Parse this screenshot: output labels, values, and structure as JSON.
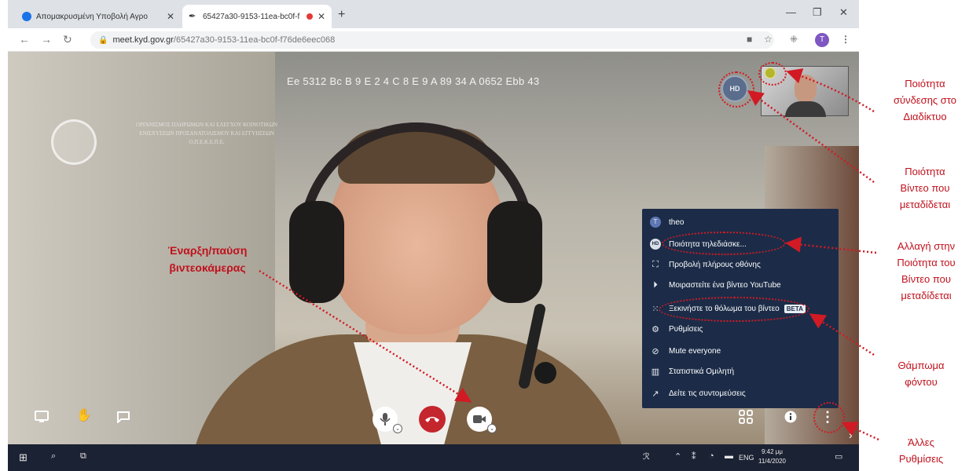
{
  "browser": {
    "tabs": [
      {
        "title": "Απομακρυσμένη Υποβολή Αγρο",
        "favicon": "plus-circle-icon",
        "favicon_color": "#1a73e8"
      },
      {
        "title": "65427a30-9153-11ea-bc0f-f",
        "favicon": "feather-icon",
        "favicon_color": "#333333",
        "recording": true
      }
    ],
    "address": {
      "host": "meet.kyd.gov.gr",
      "path": "/65427a30-9153-11ea-bc0f-f76de6eec068"
    },
    "profile_initial": "T"
  },
  "meeting": {
    "room_code": "Ee 5312 Bc B 9 E 2 4 C 8 E 9 A 89 34 A 0652 Ebb 43",
    "watermark_lines": [
      "ΟΡΓΑΝΙΣΜΟΣ ΠΛΗΡΩΜΩΝ ΚΑΙ ΕΛΕΓΧΟΥ ΚΟΙΝΟΤΙΚΩΝ",
      "ΕΝΙΣΧΥΣΕΩΝ ΠΡΟΣΑΝΑΤΟΛΙΣΜΟΥ ΚΑΙ ΕΓΓΥΗΣΕΩΝ",
      "Ο.Π.Ε.Κ.Ε.Π.Ε."
    ],
    "logo_text": "Ο.Π.Ε.Κ.Ε.Π.Ε.",
    "quality_badge": "HD",
    "connection_indicator_color": "#b5b52e"
  },
  "menu": {
    "items": [
      {
        "label": "theo",
        "icon": "user-avatar-icon",
        "avatar": "T"
      },
      {
        "label": "Ποιότητα τηλεδιάσκε...",
        "icon": "hd-icon",
        "badge": "HD"
      },
      {
        "label": "Προβολή πλήρους οθόνης",
        "icon": "fullscreen-icon"
      },
      {
        "label": "Μοιραστείτε ένα βίντεο YouTube",
        "icon": "play-icon"
      },
      {
        "label": "Ξεκινήστε το θόλωμα του βίντεο",
        "icon": "blur-icon",
        "tag": "BETA"
      },
      {
        "label": "Ρυθμίσεις",
        "icon": "gear-icon"
      },
      {
        "label": "Mute everyone",
        "icon": "mic-off-icon"
      },
      {
        "label": "Στατιστικά Ομιλητή",
        "icon": "stats-icon"
      },
      {
        "label": "Δείτε τις συντομεύσεις",
        "icon": "shortcut-icon"
      }
    ]
  },
  "toolbar": {
    "left": [
      "screen-share-icon",
      "raise-hand-icon",
      "chat-icon"
    ],
    "center": [
      "microphone-icon",
      "hangup-icon",
      "camera-icon"
    ],
    "right": [
      "tile-view-icon",
      "info-icon",
      "more-options-icon"
    ],
    "hangup_color": "#c4262e"
  },
  "taskbar": {
    "language": "ENG",
    "time": "9:42 μμ",
    "date": "11/4/2020"
  },
  "annotations": {
    "connection_quality": [
      "Ποιότητα",
      "σύνδεσης στο",
      "Διαδίκτυο"
    ],
    "video_quality": [
      "Ποιότητα",
      "Βίντεο που",
      "μεταδίδεται"
    ],
    "change_quality": [
      "Αλλαγή στην",
      "Ποιότητα του",
      "Βίντεο που",
      "μεταδίδεται"
    ],
    "background_blur": [
      "Θάμπωμα",
      "φόντου"
    ],
    "other_settings": [
      "Άλλες",
      "Ρυθμίσεις"
    ],
    "camera_toggle": [
      "Έναρξη/παύση",
      "βιντεοκάμερας"
    ],
    "color": "#c0111d"
  }
}
